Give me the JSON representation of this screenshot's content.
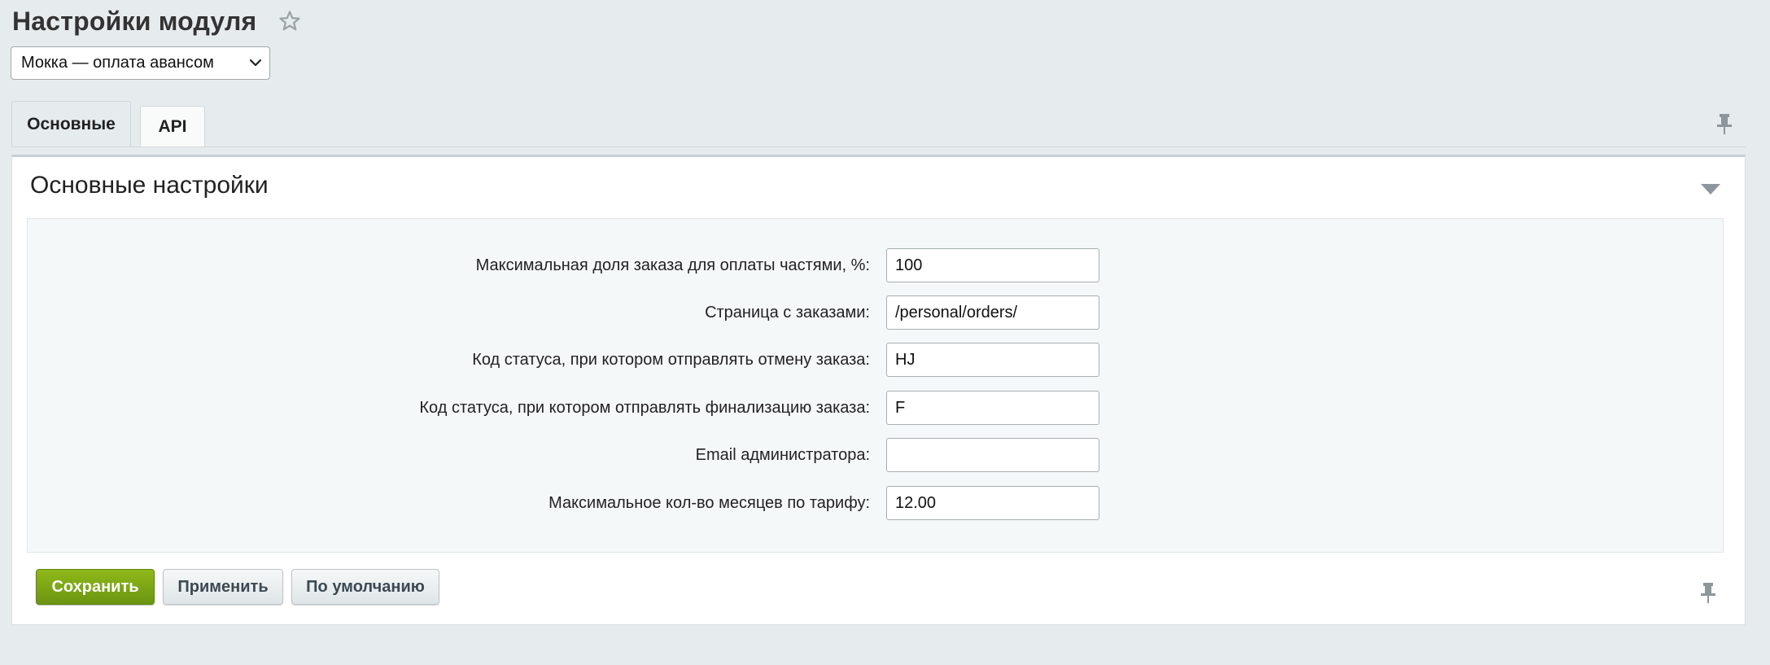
{
  "page": {
    "title": "Настройки модуля"
  },
  "module_select": {
    "value": "Мокка — оплата авансом"
  },
  "tabs": [
    {
      "label": "Основные",
      "active": true
    },
    {
      "label": "API",
      "active": false
    }
  ],
  "section": {
    "title": "Основные настройки"
  },
  "form": {
    "fields": [
      {
        "label": "Максимальная доля заказа для оплаты частями, %:",
        "value": "100"
      },
      {
        "label": "Страница с заказами:",
        "value": "/personal/orders/"
      },
      {
        "label": "Код статуса, при котором отправлять отмену заказа:",
        "value": "HJ"
      },
      {
        "label": "Код статуса, при котором отправлять финализацию заказа:",
        "value": "F"
      },
      {
        "label": "Email администратора:",
        "value": ""
      },
      {
        "label": "Максимальное кол-во месяцев по тарифу:",
        "value": "12.00"
      }
    ]
  },
  "buttons": {
    "save_label": "Сохранить",
    "apply_label": "Применить",
    "default_label": "По умолчанию"
  },
  "icons": {
    "favorite": "star-icon",
    "dropdown": "chevron-down-icon",
    "pin": "pin-icon",
    "collapse": "triangle-down-icon"
  },
  "colors": {
    "background": "#e6ebed",
    "primary_button": "#7ea716",
    "panel": "#ffffff",
    "form_area": "#f5f8f9"
  }
}
